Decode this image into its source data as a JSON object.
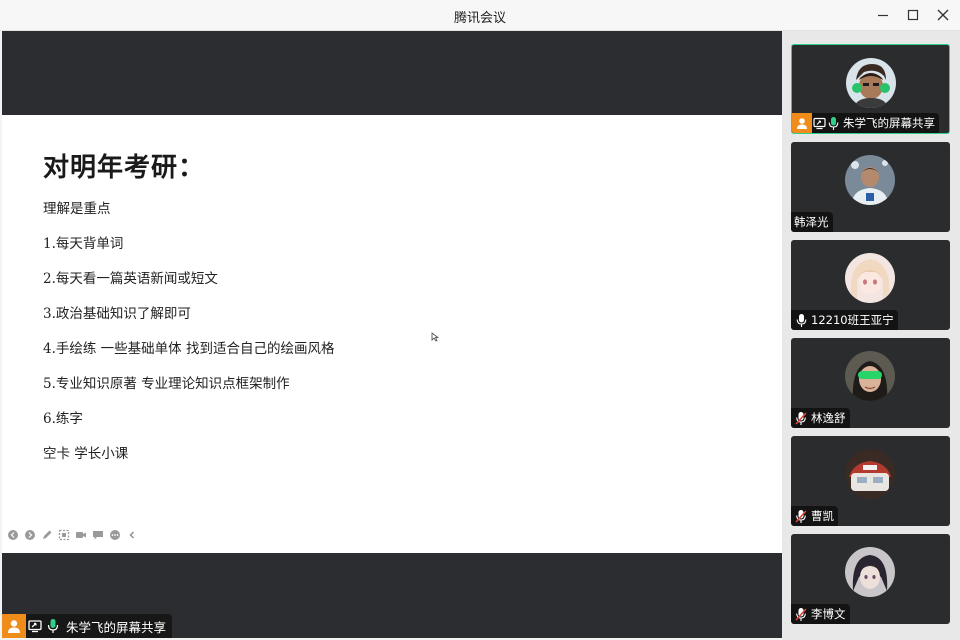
{
  "window": {
    "title": "腾讯会议"
  },
  "slide": {
    "heading": "对明年考研：",
    "lines": [
      "理解是重点",
      "1.每天背单词",
      "2.每天看一篇英语新闻或短文",
      "3.政治基础知识了解即可",
      "4.手绘练 一些基础单体 找到适合自己的绘画风格",
      "5.专业知识原著 专业理论知识点框架制作",
      "6.练字",
      "空卡 学长小课"
    ]
  },
  "share_label": "朱学飞的屏幕共享",
  "participants": [
    {
      "name": "朱学飞的屏幕共享",
      "mic": "on",
      "active": true,
      "avatar": "anime-boy-green-headphones"
    },
    {
      "name": "韩泽光",
      "mic": "none",
      "active": false,
      "avatar": "football-player"
    },
    {
      "name": "12210班王亚宁",
      "mic": "on-white",
      "active": false,
      "avatar": "anime-girl-blonde"
    },
    {
      "name": "林逸舒",
      "mic": "muted",
      "active": false,
      "avatar": "girl-green-sunglasses"
    },
    {
      "name": "曹凯",
      "mic": "muted",
      "active": false,
      "avatar": "car-image"
    },
    {
      "name": "李博文",
      "mic": "muted",
      "active": false,
      "avatar": "anime-boy-dark-hair"
    }
  ],
  "colors": {
    "accent": "#2fd08a",
    "orange": "#f08c1a",
    "panel": "#2b2c2e",
    "muted": "#e0433a"
  }
}
